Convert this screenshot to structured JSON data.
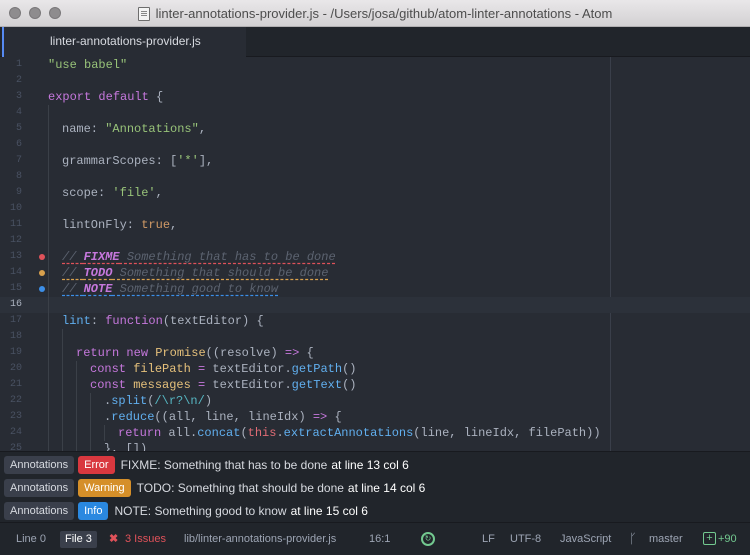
{
  "window": {
    "title": "linter-annotations-provider.js - /Users/josa/github/atom-linter-annotations - Atom"
  },
  "tab": {
    "label": "linter-annotations-provider.js"
  },
  "editor": {
    "line_numbers": [
      "1",
      "2",
      "3",
      "4",
      "5",
      "6",
      "7",
      "8",
      "9",
      "10",
      "11",
      "12",
      "13",
      "14",
      "15",
      "16",
      "17",
      "18",
      "19",
      "20",
      "21",
      "22",
      "23",
      "24",
      "25"
    ],
    "current_line": "16",
    "gutter_markers": {
      "13": "error",
      "14": "warning",
      "15": "info"
    },
    "code": {
      "l1": "\"use babel\"",
      "l3a": "export",
      "l3b": "default",
      "l3c": "{",
      "l5a": "name: ",
      "l5b": "\"Annotations\"",
      "l5c": ",",
      "l7a": "grammarScopes: [",
      "l7b": "'*'",
      "l7c": "],",
      "l9a": "scope: ",
      "l9b": "'file'",
      "l9c": ",",
      "l11a": "lintOnFly: ",
      "l11b": "true",
      "l11c": ",",
      "l13a": "// ",
      "l13b": "FIXME",
      "l13c": " Something that has to be done",
      "l14a": "// ",
      "l14b": "TODO",
      "l14c": " Something that should be done",
      "l15a": "// ",
      "l15b": "NOTE",
      "l15c": " Something good to know",
      "l17a": "lint",
      "l17b": ": ",
      "l17c": "function",
      "l17d": "(textEditor) {",
      "l19a": "return",
      "l19b": " ",
      "l19c": "new",
      "l19d": " ",
      "l19e": "Promise",
      "l19f": "((resolve) ",
      "l19g": "=>",
      "l19h": " {",
      "l20a": "const",
      "l20b": " filePath ",
      "l20c": "=",
      "l20d": " textEditor.",
      "l20e": "getPath",
      "l20f": "()",
      "l21a": "const",
      "l21b": " messages ",
      "l21c": "=",
      "l21d": " textEditor.",
      "l21e": "getText",
      "l21f": "()",
      "l22a": ".",
      "l22b": "split",
      "l22c": "(",
      "l22d": "/\\r?\\n/",
      "l22e": ")",
      "l23a": ".",
      "l23b": "reduce",
      "l23c": "((all, line, lineIdx) ",
      "l23d": "=>",
      "l23e": " {",
      "l24a": "return",
      "l24b": " all.",
      "l24c": "concat",
      "l24d": "(",
      "l24e": "this",
      "l24f": ".",
      "l24g": "extractAnnotations",
      "l24h": "(line, lineIdx, filePath))",
      "l25a": "}, [])"
    }
  },
  "linter_panel": {
    "messages": [
      {
        "source": "Annotations",
        "severity": "Error",
        "severity_color": "#d9383f",
        "text": "FIXME: Something that has to be done",
        "location": "at line 13 col 6"
      },
      {
        "source": "Annotations",
        "severity": "Warning",
        "severity_color": "#d58f29",
        "text": "TODO: Something that should be done",
        "location": "at line 14 col 6"
      },
      {
        "source": "Annotations",
        "severity": "Info",
        "severity_color": "#2a88e0",
        "text": "NOTE: Something good to know",
        "location": "at line 15 col 6"
      }
    ]
  },
  "status_bar": {
    "scope_line": "Line 0",
    "scope_file": "File 3",
    "issues_icon": "close-icon",
    "issues_count": "3 Issues",
    "file_path": "lib/linter-annotations-provider.js",
    "cursor": "16:1",
    "line_ending": "LF",
    "encoding": "UTF-8",
    "grammar": "JavaScript",
    "branch": "master",
    "diff": "+90",
    "colors": {
      "accent": "#568af2",
      "error": "#e0525a",
      "ok": "#73c990"
    }
  }
}
